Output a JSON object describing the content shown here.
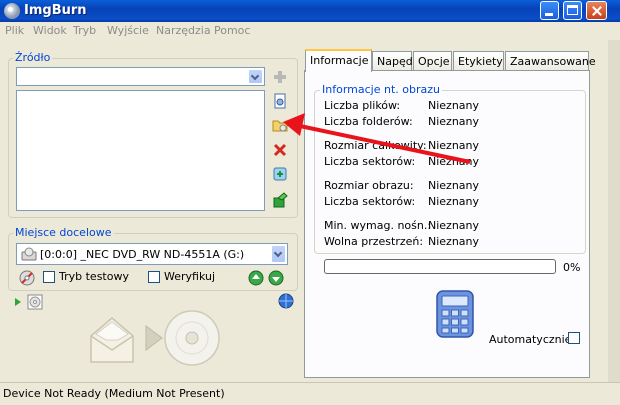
{
  "window": {
    "title": "ImgBurn"
  },
  "menu": [
    "Plik",
    "Widok",
    "Tryb",
    "Wyjście",
    "Narzędzia",
    "Pomoc"
  ],
  "source": {
    "legend": "Źródło",
    "combo_value": ""
  },
  "destination": {
    "legend": "Miejsce docelowe",
    "drive": "[0:0:0] _NEC DVD_RW ND-4551A (G:)",
    "test_mode_label": "Tryb testowy",
    "verify_label": "Weryfikuj"
  },
  "tabs": [
    "Informacje",
    "Napęd",
    "Opcje",
    "Etykiety",
    "Zaawansowane"
  ],
  "info": {
    "legend": "Informacje nt. obrazu",
    "rows": [
      {
        "label": "Liczba plików:",
        "value": "Nieznany"
      },
      {
        "label": "Liczba folderów:",
        "value": "Nieznany"
      },
      {
        "label": "Rozmiar całkowity:",
        "value": "Nieznany"
      },
      {
        "label": "Liczba sektorów:",
        "value": "Nieznany"
      },
      {
        "label": "Rozmiar obrazu:",
        "value": "Nieznany"
      },
      {
        "label": "Liczba sektorów:",
        "value": "Nieznany"
      },
      {
        "label": "Min. wymag. nośn.:",
        "value": "Nieznany"
      },
      {
        "label": "Wolna przestrzeń:",
        "value": "Nieznany"
      }
    ],
    "progress_percent": 0,
    "progress_label": "0%",
    "auto_label": "Automatycznie"
  },
  "status": "Device Not Ready (Medium Not Present)",
  "colors": {
    "arrow": "#e8141c",
    "legend": "#0046d5",
    "titlebar": "#0a4ec8"
  }
}
